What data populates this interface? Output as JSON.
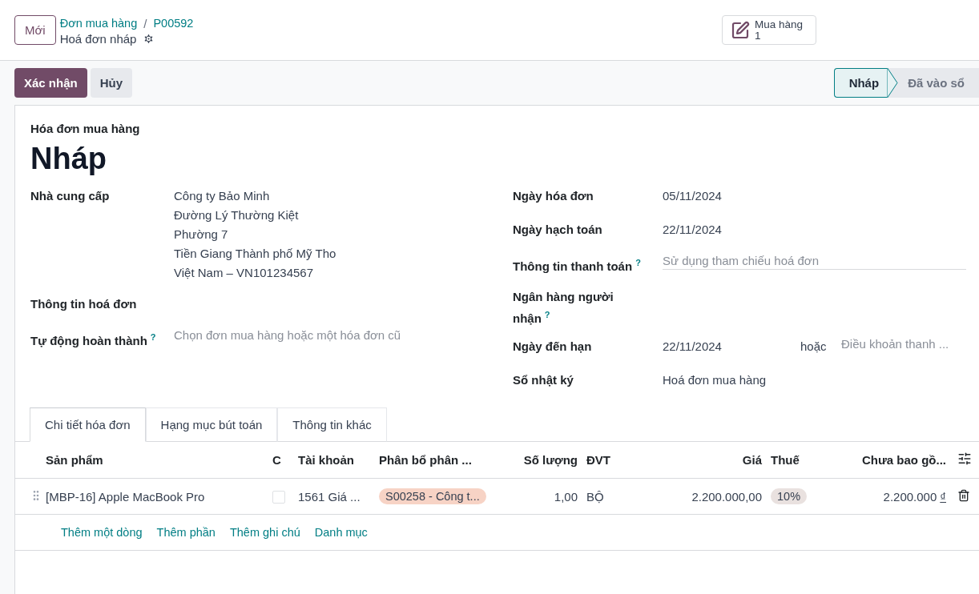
{
  "new_button": "Mới",
  "breadcrumb": {
    "parent": "Đơn mua hàng",
    "separator": "/",
    "current": "P00592",
    "record": "Hoá đơn nháp"
  },
  "smart_button": {
    "label": "Mua hàng",
    "count": "1"
  },
  "actions": [
    {
      "label": "Xác nhận",
      "primary": true
    },
    {
      "label": "Hủy",
      "primary": false
    }
  ],
  "status_steps": [
    {
      "label": "Nháp",
      "selected": true
    },
    {
      "label": "Đã vào sổ",
      "selected": false
    }
  ],
  "form": {
    "type_label": "Hóa đơn mua hàng",
    "title": "Nháp",
    "left_fields": [
      {
        "kind": "address",
        "label": "Nhà cung cấp",
        "lines": [
          "Công ty Bảo Minh",
          "Đường Lý Thường Kiệt",
          "Phường 7",
          "Tiền Giang Thành phố Mỹ Tho",
          "Việt Nam – VN101234567"
        ]
      },
      {
        "kind": "empty",
        "label": "Thông tin hoá đơn"
      },
      {
        "kind": "input",
        "label": "Tự động hoàn thành",
        "help": "?",
        "placeholder": "Chọn đơn mua hàng hoặc một hóa đơn cũ"
      }
    ],
    "right_fields": [
      {
        "kind": "text",
        "label": "Ngày hóa đơn",
        "value": "05/11/2024"
      },
      {
        "kind": "text",
        "label": "Ngày hạch toán",
        "value": "22/11/2024"
      },
      {
        "kind": "input",
        "label": "Thông tin thanh toán",
        "help": "?",
        "placeholder": "Sử dụng tham chiếu hoá đơn"
      },
      {
        "kind": "empty",
        "label": "Ngân hàng người nhận",
        "help": "?"
      },
      {
        "kind": "due",
        "label": "Ngày đến hạn",
        "value": "22/11/2024",
        "connector": "hoặc",
        "placeholder": "Điều khoản thanh ..."
      },
      {
        "kind": "text",
        "label": "Sổ nhật ký",
        "value": "Hoá đơn mua hàng"
      }
    ]
  },
  "tabs": [
    {
      "label": "Chi tiết hóa đơn",
      "selected": true
    },
    {
      "label": "Hạng mục bút toán",
      "selected": false
    },
    {
      "label": "Thông tin khác",
      "selected": false
    }
  ],
  "table": {
    "columns": [
      "Sản phẩm",
      "C",
      "Tài khoản",
      "Phân bổ phân ...",
      "Số lượng",
      "ĐVT",
      "Giá",
      "Thuế",
      "Chưa bao gồ..."
    ],
    "rows": [
      {
        "product": "[MBP-16] Apple MacBook Pro",
        "checked": false,
        "account": "1561 Giá ...",
        "analytic": "S00258 - Công t...",
        "quantity": "1,00",
        "uom": "BỘ",
        "price": "2.200.000,00",
        "tax": "10%",
        "subtotal": "2.200.000",
        "currency": "₫"
      }
    ]
  },
  "add_links": [
    "Thêm một dòng",
    "Thêm phần",
    "Thêm ghi chú",
    "Danh mục"
  ]
}
